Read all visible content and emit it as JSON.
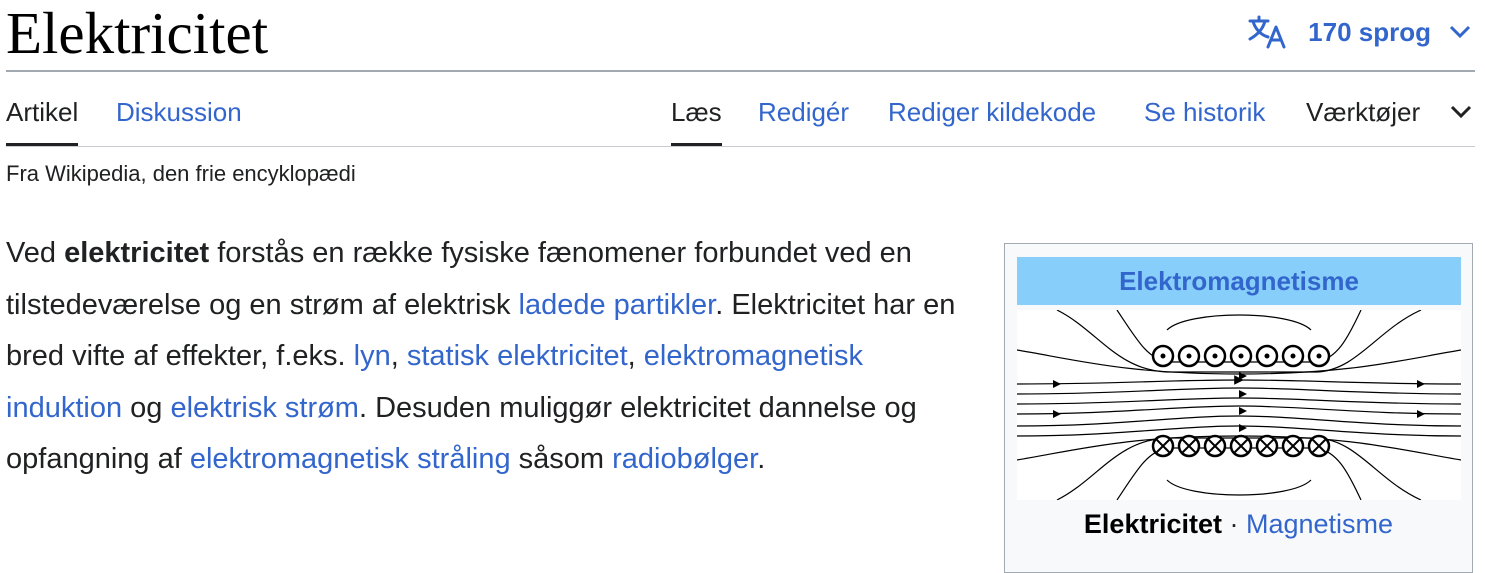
{
  "header": {
    "title": "Elektricitet",
    "languages_label": "170 sprog"
  },
  "tabs": {
    "left": [
      {
        "label": "Artikel",
        "selected": true
      },
      {
        "label": "Diskussion",
        "selected": false
      }
    ],
    "right": [
      {
        "label": "Læs",
        "selected": true
      },
      {
        "label": "Redigér",
        "selected": false
      },
      {
        "label": "Rediger kildekode",
        "selected": false
      },
      {
        "label": "Se historik",
        "selected": false
      },
      {
        "label": "Værktøjer",
        "selected": false
      }
    ]
  },
  "tagline": "Fra Wikipedia, den frie encyklopædi",
  "intro": {
    "p1": "Ved ",
    "bold": "elektricitet",
    "p2": " forstås en række fysiske fænomener forbundet ved en tilstedeværelse og en strøm af elektrisk ",
    "link_ladede": "ladede partikler",
    "p3": ". Elektricitet har en bred vifte af effekter, f.eks. ",
    "link_lyn": "lyn",
    "p4": ", ",
    "link_statisk": "statisk elektricitet",
    "p5": ", ",
    "link_induktion": "elektromagnetisk induktion",
    "p6": " og ",
    "link_strom": "elektrisk strøm",
    "p7": ". Desuden muliggør elektricitet dannelse og opfangning af ",
    "link_straaling": "elektromagnetisk stråling",
    "p8": " såsom ",
    "link_radio": "radiobølger",
    "p9": "."
  },
  "infobox": {
    "heading": "Elektromagnetisme",
    "footer_bold": "Elektricitet",
    "footer_sep": " · ",
    "footer_link": "Magnetisme"
  },
  "icons": {
    "language": "translate-icon",
    "chevron": "chevron-down-icon"
  },
  "colors": {
    "link": "#3366cc",
    "text": "#202122",
    "infobox_header": "#87cefa",
    "border": "#a2a9b1"
  }
}
